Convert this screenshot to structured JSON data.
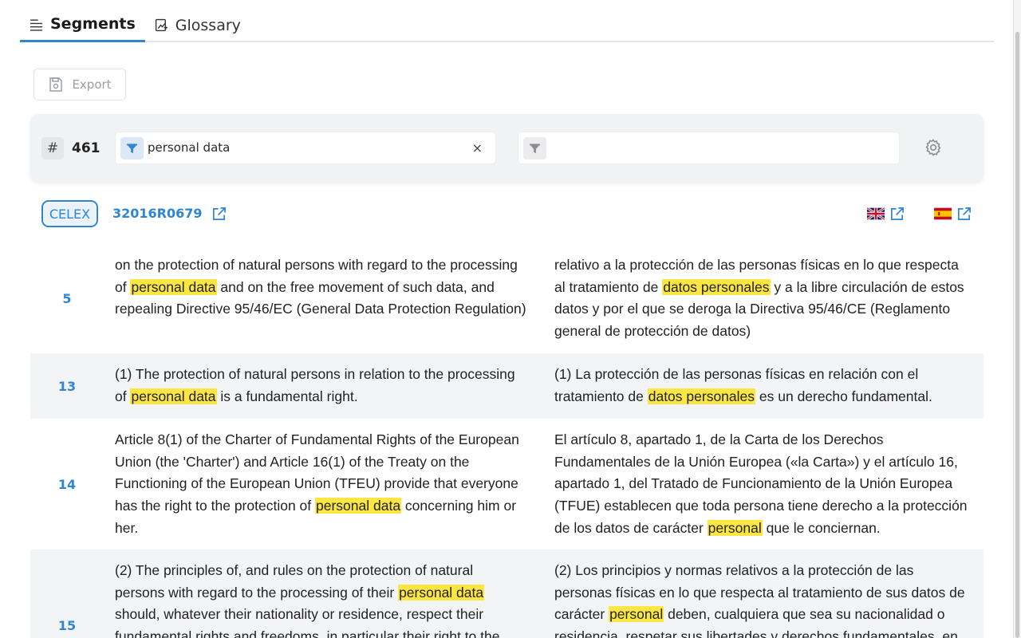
{
  "tabs": [
    {
      "label": "Segments",
      "icon": "list-icon",
      "active": true
    },
    {
      "label": "Glossary",
      "icon": "glossary-icon",
      "active": false
    }
  ],
  "toolbar": {
    "export_label": "Export"
  },
  "filter": {
    "count": "461",
    "source_query": "personal data",
    "target_query": "",
    "clear_symbol": "×"
  },
  "document": {
    "badge": "CELEX",
    "id": "32016R0679",
    "source_lang_flag": "uk-flag",
    "target_lang_flag": "es-flag"
  },
  "segments": [
    {
      "num": "5",
      "source": [
        "on the protection of natural persons with regard to the processing",
        "of ",
        {
          "hl": "personal data"
        },
        " and on the free movement of such data, and",
        "repealing Directive 95/46/EC (General Data Protection Regulation)"
      ],
      "source_lines": [
        [
          {
            "t": "on the protection of natural persons with regard to the processing"
          }
        ],
        [
          {
            "t": "of "
          },
          {
            "hl": "personal data"
          },
          {
            "t": " and on the free movement of such data, and"
          }
        ],
        [
          {
            "t": "repealing Directive 95/46/EC (General Data Protection Regulation)"
          }
        ]
      ],
      "target_lines": [
        [
          {
            "t": "relativo a la protección de las personas físicas en lo que respecta"
          }
        ],
        [
          {
            "t": "al tratamiento de "
          },
          {
            "hl": "datos personales"
          },
          {
            "t": " y a la libre circulación de estos"
          }
        ],
        [
          {
            "t": "datos y por el que se deroga la Directiva 95/46/CE (Reglamento"
          }
        ],
        [
          {
            "t": "general de protección de datos)"
          }
        ]
      ]
    },
    {
      "num": "13",
      "source_lines": [
        [
          {
            "t": "(1) The protection of natural persons in relation to the processing"
          }
        ],
        [
          {
            "t": "of "
          },
          {
            "hl": "personal data"
          },
          {
            "t": " is a fundamental right."
          }
        ]
      ],
      "target_lines": [
        [
          {
            "t": "(1) La protección de las personas físicas en relación con el"
          }
        ],
        [
          {
            "t": "tratamiento de "
          },
          {
            "hl": "datos personales"
          },
          {
            "t": " es un derecho fundamental."
          }
        ]
      ]
    },
    {
      "num": "14",
      "source_lines": [
        [
          {
            "t": "Article 8(1) of the Charter of Fundamental Rights of the European"
          }
        ],
        [
          {
            "t": "Union (the 'Charter') and Article 16(1) of the Treaty on the"
          }
        ],
        [
          {
            "t": "Functioning of the European Union (TFEU) provide that everyone"
          }
        ],
        [
          {
            "t": "has the right to the protection of "
          },
          {
            "hl": "personal data"
          },
          {
            "t": " concerning him or"
          }
        ],
        [
          {
            "t": "her."
          }
        ]
      ],
      "target_lines": [
        [
          {
            "t": "El artículo 8, apartado 1, de la Carta de los Derechos"
          }
        ],
        [
          {
            "t": "Fundamentales de la Unión Europea («la Carta») y el artículo 16,"
          }
        ],
        [
          {
            "t": "apartado 1, del Tratado de Funcionamiento de la Unión Europea"
          }
        ],
        [
          {
            "t": "(TFUE) establecen que toda persona tiene derecho a la protección"
          }
        ],
        [
          {
            "t": "de los datos de carácter "
          },
          {
            "hl": "personal"
          },
          {
            "t": " que le conciernan."
          }
        ]
      ]
    },
    {
      "num": "15",
      "source_lines": [
        [
          {
            "t": "(2) The principles of, and rules on the protection of natural"
          }
        ],
        [
          {
            "t": "persons with regard to the processing of their "
          },
          {
            "hl": "personal data"
          }
        ],
        [
          {
            "t": "should, whatever their nationality or residence, respect their"
          }
        ],
        [
          {
            "t": "fundamental rights and freedoms, in particular their right to the"
          }
        ]
      ],
      "target_lines": [
        [
          {
            "t": "(2) Los principios y normas relativos a la protección de las"
          }
        ],
        [
          {
            "t": "personas físicas en lo que respecta al tratamiento de sus datos de"
          }
        ],
        [
          {
            "t": "carácter "
          },
          {
            "hl": "personal"
          },
          {
            "t": " deben, cualquiera que sea su nacionalidad o"
          }
        ],
        [
          {
            "t": "residencia, respetar sus libertades y derechos fundamentales, en"
          }
        ]
      ]
    }
  ]
}
